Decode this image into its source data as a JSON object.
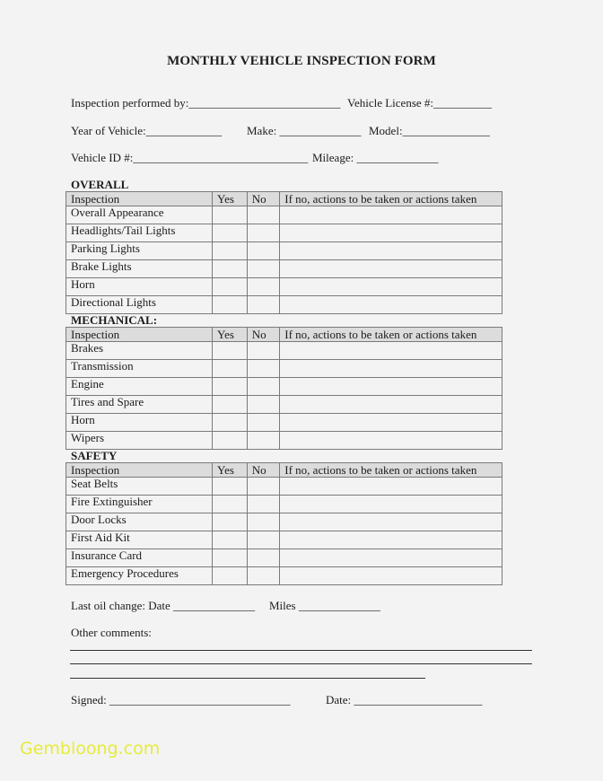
{
  "title": "MONTHLY VEHICLE INSPECTION FORM",
  "fields": {
    "inspection_by": "Inspection performed by:__________________________",
    "vehicle_license": "Vehicle License #:__________",
    "year": "Year of Vehicle:_____________",
    "make": "Make: ______________",
    "model": "Model:_______________",
    "vehicle_id": "Vehicle ID #:______________________________",
    "mileage": "Mileage: ______________"
  },
  "table_headers": {
    "inspection": "Inspection",
    "yes": "Yes",
    "no": "No",
    "actions": "If no, actions to be taken or actions taken"
  },
  "sections": [
    {
      "title": "OVERALL",
      "items": [
        "Overall Appearance",
        "Headlights/Tail Lights",
        "Parking Lights",
        "Brake Lights",
        "Horn",
        "Directional Lights"
      ]
    },
    {
      "title": "MECHANICAL:",
      "items": [
        "Brakes",
        "Transmission",
        "Engine",
        "Tires and Spare",
        "Horn",
        "Wipers"
      ]
    },
    {
      "title": "SAFETY",
      "items": [
        "Seat Belts",
        "Fire Extinguisher",
        "Door Locks",
        "First Aid Kit",
        "Insurance Card",
        "Emergency Procedures"
      ]
    }
  ],
  "footer": {
    "oil_change": "Last oil change: Date ______________",
    "miles": "Miles ______________",
    "comments_label": "Other comments:",
    "signed": "Signed: _______________________________",
    "date": "Date: ______________________"
  },
  "watermark": "Gembloong.com",
  "colors": {
    "header_fill": "#dcdcdc",
    "watermark": "#e6ec3a"
  }
}
